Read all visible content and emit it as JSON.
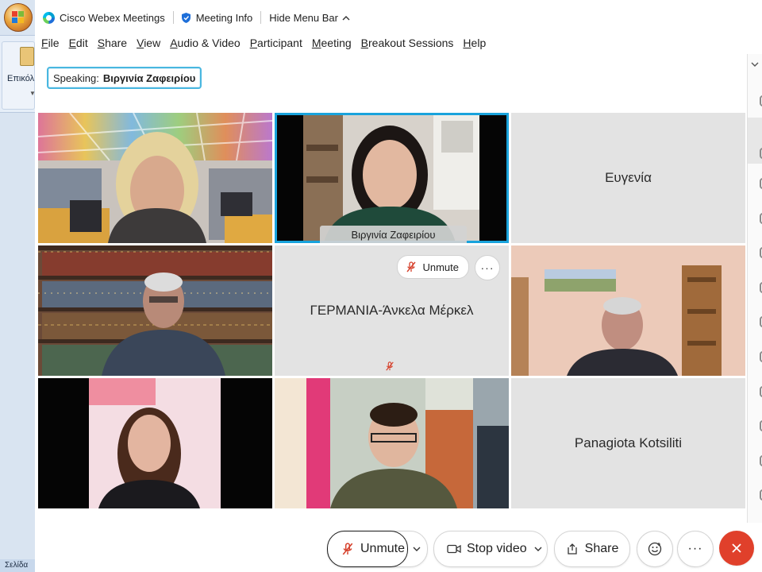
{
  "background_app": {
    "ribbon_button_label": "Επικόλ",
    "status_text": "Σελίδα"
  },
  "titlebar": {
    "app_name": "Cisco Webex Meetings",
    "meeting_info": "Meeting Info",
    "hide_menu_bar": "Hide Menu Bar"
  },
  "menu": {
    "items": [
      {
        "u": "F",
        "rest": "ile"
      },
      {
        "u": "E",
        "rest": "dit"
      },
      {
        "u": "S",
        "rest": "hare"
      },
      {
        "u": "V",
        "rest": "iew"
      },
      {
        "u": "A",
        "rest": "udio & Video"
      },
      {
        "u": "P",
        "rest": "articipant"
      },
      {
        "u": "M",
        "rest": "eeting"
      },
      {
        "u": "B",
        "rest": "reakout Sessions"
      },
      {
        "u": "H",
        "rest": "elp"
      }
    ]
  },
  "speaking": {
    "label": "Speaking:",
    "name": "Βιργινία Ζαφειρίου"
  },
  "tiles": {
    "t1": {
      "type": "video"
    },
    "t2": {
      "type": "video",
      "name_badge": "Βιργινία Ζαφειρίου",
      "active_speaker": true
    },
    "t3": {
      "type": "name",
      "name": "Ευγενία"
    },
    "t4": {
      "type": "video"
    },
    "t5": {
      "type": "name",
      "name": "ΓΕΡΜΑΝΙΑ-Άνκελα Μέρκελ",
      "unmute_label": "Unmute",
      "more_label": "···",
      "muted": true
    },
    "t6": {
      "type": "video"
    },
    "t7": {
      "type": "video"
    },
    "t8": {
      "type": "video"
    },
    "t9": {
      "type": "name",
      "name": "Panagiota Kotsiliti"
    }
  },
  "controls": {
    "unmute": "Unmute",
    "stop_video": "Stop video",
    "share": "Share",
    "more": "···",
    "leave_icon": "close-icon"
  },
  "colors": {
    "active_speaker_border": "#19a3dc",
    "leave_button": "#e0402b",
    "muted_icon": "#d6402b"
  }
}
